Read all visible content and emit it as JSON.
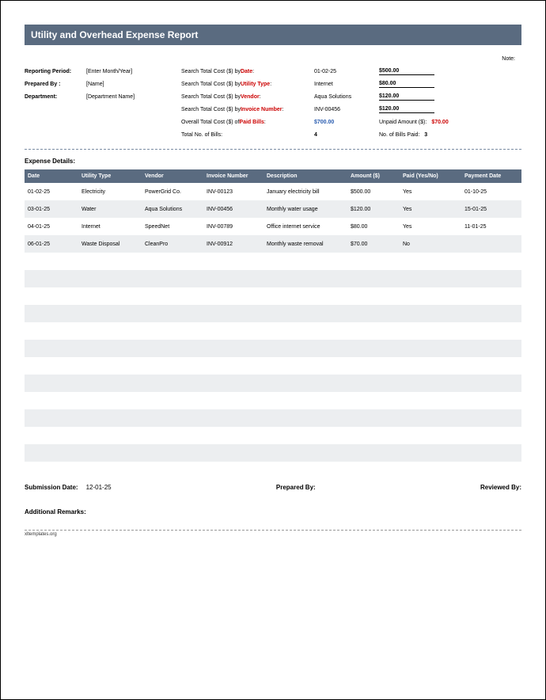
{
  "title": "Utility and Overhead Expense Report",
  "note_label": "Note:",
  "meta_left": [
    {
      "label": "Reporting Period:",
      "value": "[Enter Month/Year]"
    },
    {
      "label": "Prepared By :",
      "value": "[Name]"
    },
    {
      "label": "Department:",
      "value": "[Department Name]"
    }
  ],
  "search_rows": [
    {
      "prefix": "Search Total Cost ($) by ",
      "key": "Date",
      "keyClass": "red",
      "suffix": ":",
      "val": "01-02-25",
      "result": "$500.00",
      "uline": true
    },
    {
      "prefix": "Search Total Cost ($) by ",
      "key": "Utility Type",
      "keyClass": "red",
      "suffix": ":",
      "val": "Internet",
      "result": "$80.00",
      "uline": true
    },
    {
      "prefix": "Search Total Cost ($) by ",
      "key": "Vendor",
      "keyClass": "red",
      "suffix": ":",
      "val": "Aqua Solutions",
      "result": "$120.00",
      "uline": true
    },
    {
      "prefix": "Search Total Cost ($) by ",
      "key": "Invoice Number",
      "keyClass": "red",
      "suffix": ":",
      "val": "INV-00456",
      "result": "$120.00",
      "uline": true
    },
    {
      "prefix": "Overall Total Cost ($) of ",
      "key": "Paid Bills",
      "keyClass": "red",
      "suffix": ":",
      "val": "$700.00",
      "valClass": "blue",
      "unpaid_label": "Unpaid Amount ($):",
      "unpaid_val": "$70.00"
    },
    {
      "prefix": "Total No. of Bills:",
      "key": "",
      "keyClass": "",
      "suffix": "",
      "val": "4",
      "valBold": true,
      "extra_label": "No. of Bills Paid:",
      "extra_val": "3"
    }
  ],
  "section_title": "Expense Details:",
  "columns": [
    "Date",
    "Utility Type",
    "Vendor",
    "Invoice Number",
    "Description",
    "Amount ($)",
    "Paid (Yes/No)",
    "Payment Date"
  ],
  "rows": [
    [
      "01-02-25",
      "Electricity",
      "PowerGrid Co.",
      "INV-00123",
      "January electricity bill",
      "$500.00",
      "Yes",
      "01-10-25"
    ],
    [
      "03-01-25",
      "Water",
      "Aqua Solutions",
      "INV-00456",
      "Monthly water usage",
      "$120.00",
      "Yes",
      "15-01-25"
    ],
    [
      "04-01-25",
      "Internet",
      "SpeedNet",
      "INV-00789",
      "Office internet service",
      "$80.00",
      "Yes",
      "11-01-25"
    ],
    [
      "06-01-25",
      "Waste Disposal",
      "CleanPro",
      "INV-00912",
      "Monthly waste removal",
      "$70.00",
      "No",
      ""
    ]
  ],
  "empty_rows": 12,
  "footer": {
    "submission_label": "Submission Date:",
    "submission_value": "12-01-25",
    "prepared_label": "Prepared By:",
    "reviewed_label": "Reviewed By:",
    "remarks_label": "Additional Remarks:",
    "watermark": "xltemplates.org"
  }
}
